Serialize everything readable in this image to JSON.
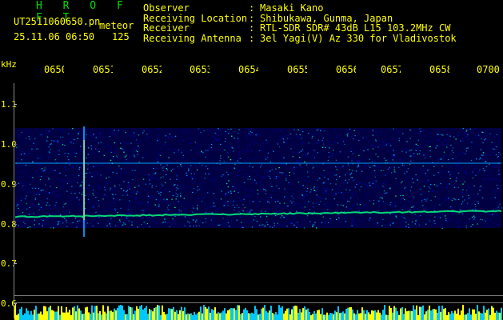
{
  "header": {
    "brand": "H R O F F T",
    "file_name": "UT2511060650.pn",
    "file_suffix": "meteor",
    "timestamp": "25.11.06 06:50",
    "count": "125"
  },
  "meta": [
    {
      "key": "Observer",
      "sep": ":",
      "value": "Masaki Kano"
    },
    {
      "key": "Receiving Location",
      "sep": ":",
      "value": "Shibukawa, Gunma, Japan"
    },
    {
      "key": "Receiver",
      "sep": ":",
      "value": "RTL-SDR SDR# 43dB L15 103.2MHz CW"
    },
    {
      "key": "Receiving Antenna",
      "sep": ":",
      "value": "3el Yagi(V) Az 330 for Vladivostok"
    }
  ],
  "y_axis": {
    "unit": "kHz",
    "labels": [
      "1.1",
      "1.0",
      "0.9",
      "0.8",
      "0.7",
      "0.6"
    ]
  },
  "time_axis": {
    "labels": [
      "0650",
      "0651",
      "0652",
      "0653",
      "0654",
      "0655",
      "0656",
      "0657",
      "0658",
      "0659",
      "0700"
    ]
  },
  "colors": {
    "background": "#000000",
    "text": "#ffff00",
    "brand": "#00e000",
    "signal_low": "#0000c0",
    "signal_mid": "#00a0ff",
    "signal_high": "#00ff80",
    "meteor": "#ffff60"
  }
}
